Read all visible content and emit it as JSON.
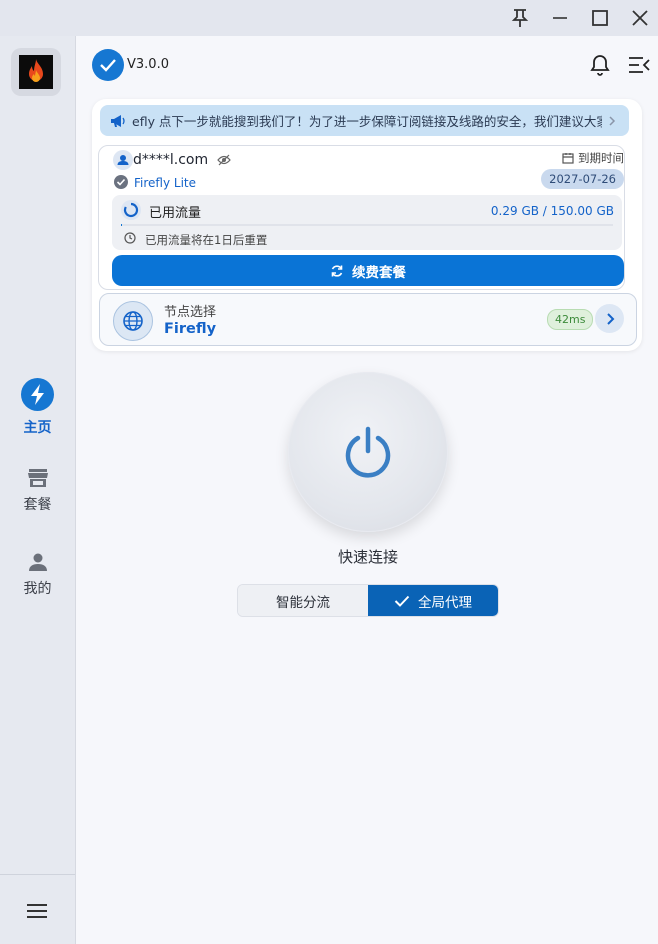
{
  "window_controls": [
    "pin-icon",
    "minimize-icon",
    "maximize-icon",
    "close-icon"
  ],
  "sidebar": {
    "logo_icon": "flame-icon",
    "items": [
      {
        "label": "主页",
        "icon": "bolt-icon",
        "active": true
      },
      {
        "label": "套餐",
        "icon": "store-icon",
        "active": false
      },
      {
        "label": "我的",
        "icon": "person-icon",
        "active": false
      }
    ],
    "menu_icon": "hamburger-menu-icon"
  },
  "header": {
    "version": "V3.0.0",
    "icons": [
      "bell-icon",
      "menu-collapse-icon"
    ]
  },
  "notice": {
    "text": "efly 点下一步就能搜到我们了！为了进一步保障订阅链接及线路的安全，我们建议大家使用",
    "icon": "megaphone-icon"
  },
  "account": {
    "email": "d****l.com",
    "plan": "Firefly Lite",
    "expire_label": "到期时间",
    "expire_date": "2027-07-26",
    "traffic": {
      "title": "已用流量",
      "amount": "0.29 GB / 150.00 GB",
      "used_fraction": 0.0019,
      "reset_note": "已用流量将在1日后重置"
    },
    "renew_label": "续费套餐"
  },
  "node": {
    "label": "节点选择",
    "name": "Firefly",
    "latency": "42ms"
  },
  "connect": {
    "label": "快速连接"
  },
  "mode": {
    "options": [
      {
        "label": "智能分流",
        "selected": false
      },
      {
        "label": "全局代理",
        "selected": true
      }
    ]
  },
  "colors": {
    "accent": "#1677d2",
    "primary_button": "#0a74d6",
    "sidebar_bg": "#e6e9f0",
    "page_bg": "#f6f7fb"
  }
}
